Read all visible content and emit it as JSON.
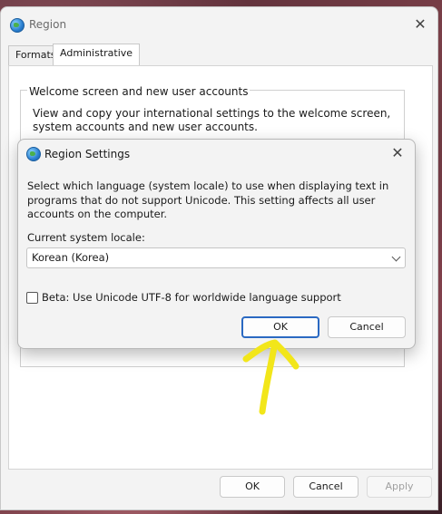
{
  "window": {
    "title": "Region",
    "close_glyph": "✕",
    "tabs": [
      {
        "label": "Formats",
        "active": false
      },
      {
        "label": "Administrative",
        "active": true
      }
    ],
    "group": {
      "legend": "Welcome screen and new user accounts",
      "description": "View and copy your international settings to the welcome screen, system accounts and new user accounts."
    },
    "footer": {
      "ok": "OK",
      "cancel": "Cancel",
      "apply": "Apply"
    }
  },
  "dialog": {
    "title": "Region Settings",
    "close_glyph": "✕",
    "description": "Select which language (system locale) to use when displaying text in programs that do not support Unicode. This setting affects all user accounts on the computer.",
    "locale_label": "Current system locale:",
    "locale_value": "Korean (Korea)",
    "beta_label": "Beta: Use Unicode UTF-8 for worldwide language support",
    "beta_checked": false,
    "ok": "OK",
    "cancel": "Cancel"
  },
  "annotation": {
    "color": "#f2e61a",
    "icon": "arrow-up-annotation"
  },
  "colors": {
    "accent": "#2a69c2",
    "dialog_bg": "#f3f3f3"
  }
}
